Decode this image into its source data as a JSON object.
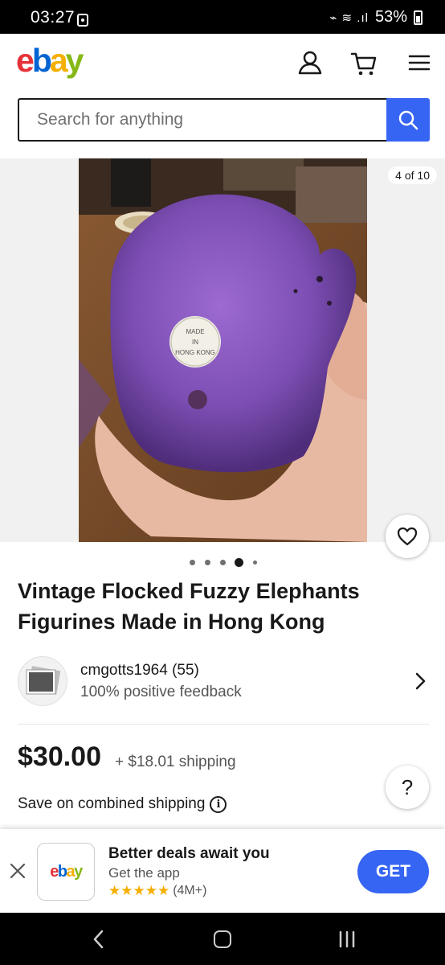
{
  "status_bar": {
    "time": "03:27",
    "signal": "⌁ ≋ .ıl",
    "battery": "53%"
  },
  "header": {
    "logo": {
      "e": "e",
      "b": "b",
      "a": "a",
      "y": "y"
    },
    "colors": {
      "e": "#e53238",
      "b": "#0064d2",
      "a": "#f5af02",
      "y": "#86b817"
    }
  },
  "search": {
    "placeholder": "Search for anything"
  },
  "gallery": {
    "counter": "4 of 10",
    "photo_alt": "purple flocked figure held in hand with sticker",
    "sticker_text": "MADE IN HONG KONG",
    "total_dots": 5,
    "active_dot": 4
  },
  "listing": {
    "title": "Vintage Flocked Fuzzy Elephants Figurines Made in Hong Kong",
    "seller_name": "cmgotts1964 (55)",
    "seller_feedback": "100% positive feedback",
    "price": "$30.00",
    "shipping": "+ $18.01 shipping",
    "combined_shipping": "Save on combined shipping",
    "help_label": "?"
  },
  "app_banner": {
    "logo": {
      "e": "e",
      "b": "b",
      "a": "a",
      "y": "y"
    },
    "title": "Better deals await you",
    "subtitle": "Get the app",
    "stars": "★★★★★",
    "rating_count": "(4M+)",
    "cta": "GET"
  },
  "accent_color": "#3665f3"
}
